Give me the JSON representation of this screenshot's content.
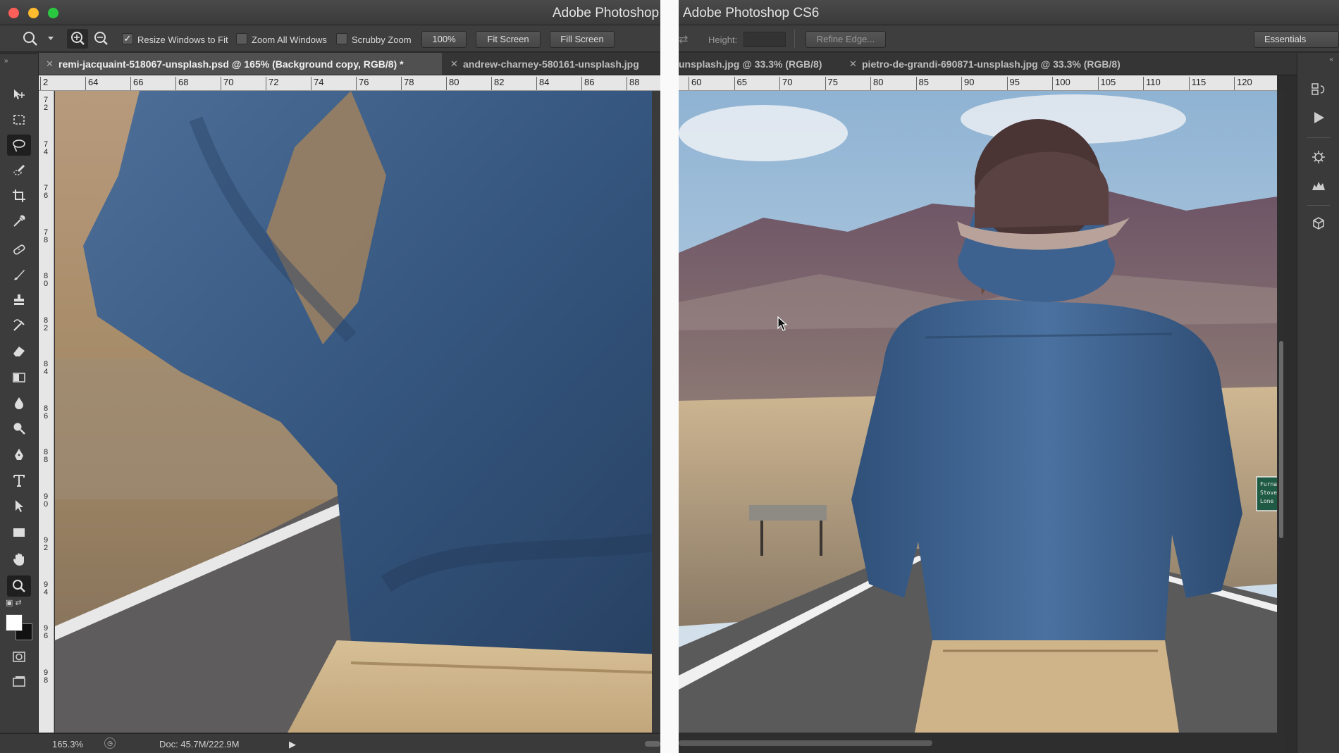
{
  "left": {
    "window_title": "Adobe Photoshop",
    "options": {
      "resize_windows_label": "Resize Windows to Fit",
      "resize_windows_checked": true,
      "zoom_all_label": "Zoom All Windows",
      "scrubby_zoom_label": "Scrubby Zoom",
      "btn_100": "100%",
      "btn_fit": "Fit Screen",
      "btn_fill": "Fill Screen"
    },
    "tabs": [
      {
        "label": "remi-jacquaint-518067-unsplash.psd @ 165% (Background copy, RGB/8) *",
        "active": true
      },
      {
        "label": "andrew-charney-580161-unsplash.jpg",
        "active": false
      }
    ],
    "ruler_h": [
      "2",
      "64",
      "66",
      "68",
      "70",
      "72",
      "74",
      "76",
      "78",
      "80",
      "82",
      "84",
      "86",
      "88"
    ],
    "ruler_v": [
      "7\n2",
      "7\n4",
      "7\n6",
      "7\n8",
      "8\n0",
      "8\n2",
      "8\n4",
      "8\n6",
      "8\n8",
      "9\n0",
      "9\n2",
      "9\n4",
      "9\n6",
      "9\n8"
    ],
    "status": {
      "zoom": "165.3%",
      "doc": "Doc: 45.7M/222.9M"
    }
  },
  "right": {
    "window_title": "Adobe Photoshop CS6",
    "options": {
      "height_label": "Height:",
      "refine_edge": "Refine Edge...",
      "workspace": "Essentials"
    },
    "tabs": [
      {
        "label": "unsplash.jpg @ 33.3% (RGB/8)",
        "active": false
      },
      {
        "label": "pietro-de-grandi-690871-unsplash.jpg @ 33.3% (RGB/8)",
        "active": false
      }
    ],
    "ruler_h": [
      "60",
      "65",
      "70",
      "75",
      "80",
      "85",
      "90",
      "95",
      "100",
      "105",
      "110",
      "115",
      "120"
    ],
    "road_sign": [
      "Furna",
      "Stove",
      "Lone"
    ]
  },
  "toolbox_icons": [
    "move-tool-icon",
    "marquee-tool-icon",
    "lasso-tool-icon",
    "quick-select-tool-icon",
    "crop-tool-icon",
    "eyedropper-tool-icon",
    "healing-brush-icon",
    "brush-tool-icon",
    "clone-stamp-icon",
    "history-brush-icon",
    "eraser-tool-icon",
    "gradient-tool-icon",
    "blur-tool-icon",
    "dodge-tool-icon",
    "pen-tool-icon",
    "type-tool-icon",
    "path-select-icon",
    "rectangle-tool-icon",
    "hand-tool-icon",
    "zoom-tool-icon"
  ]
}
